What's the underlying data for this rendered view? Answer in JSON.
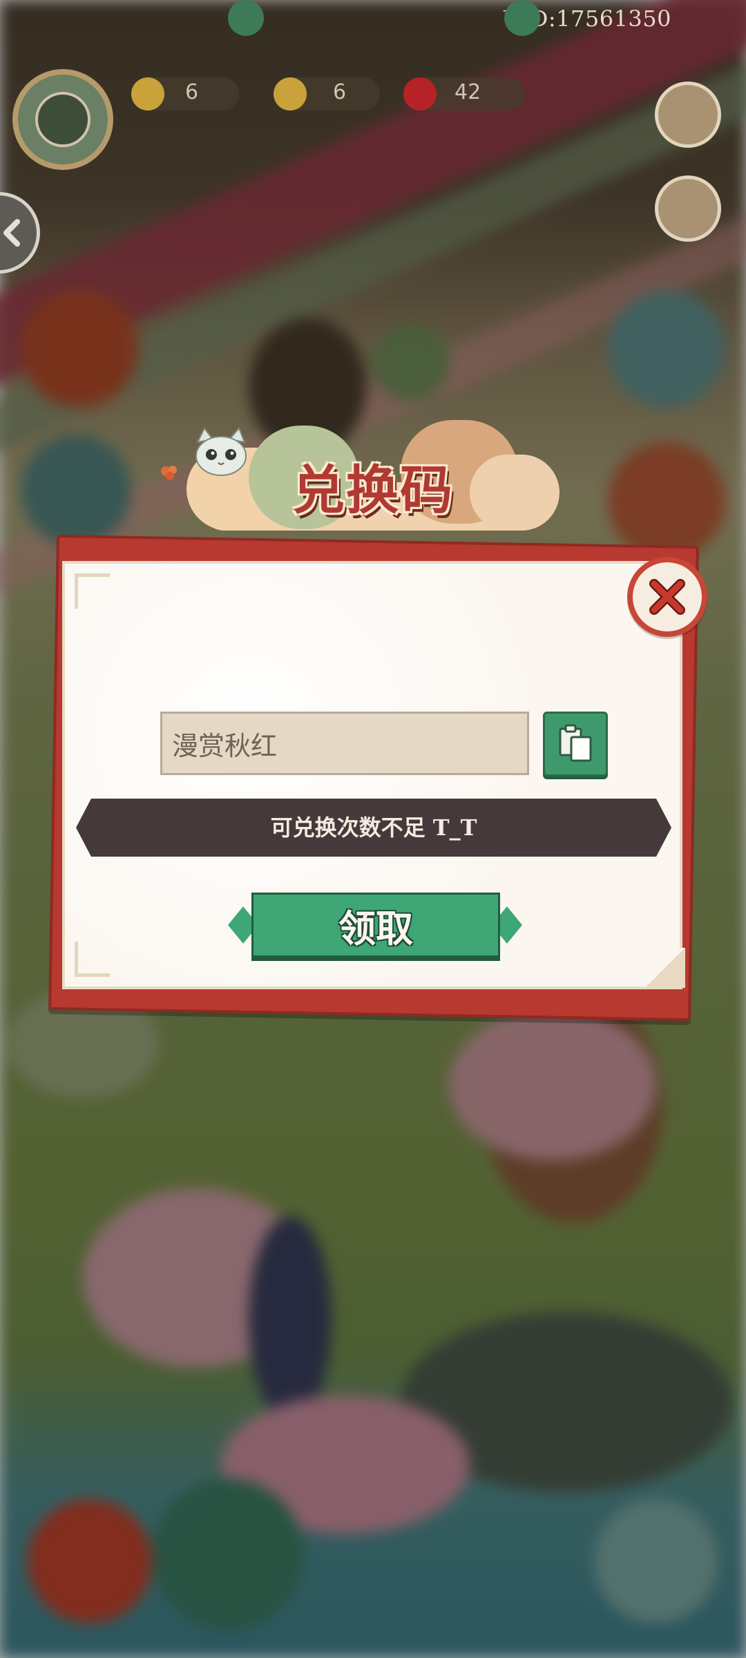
{
  "hud": {
    "uid": "UID:17561350",
    "resources": [
      {
        "name": "energy",
        "value": "6",
        "icon": "lightning-icon",
        "color": "#d9b23a"
      },
      {
        "name": "coin",
        "value": "6",
        "icon": "coin-icon",
        "color": "#d7a93a"
      },
      {
        "name": "ruby",
        "value": "42",
        "icon": "ruby-icon",
        "color": "#c8262b"
      }
    ]
  },
  "dialog": {
    "title": "兑换码",
    "code_value": "漫赏秋红",
    "message": "可兑换次数不足 T_T",
    "claim_label": "领取"
  },
  "colors": {
    "accent_red": "#b7392f",
    "button_green": "#3fa775",
    "message_bg": "#45393b",
    "paper": "#fbf6ef"
  }
}
